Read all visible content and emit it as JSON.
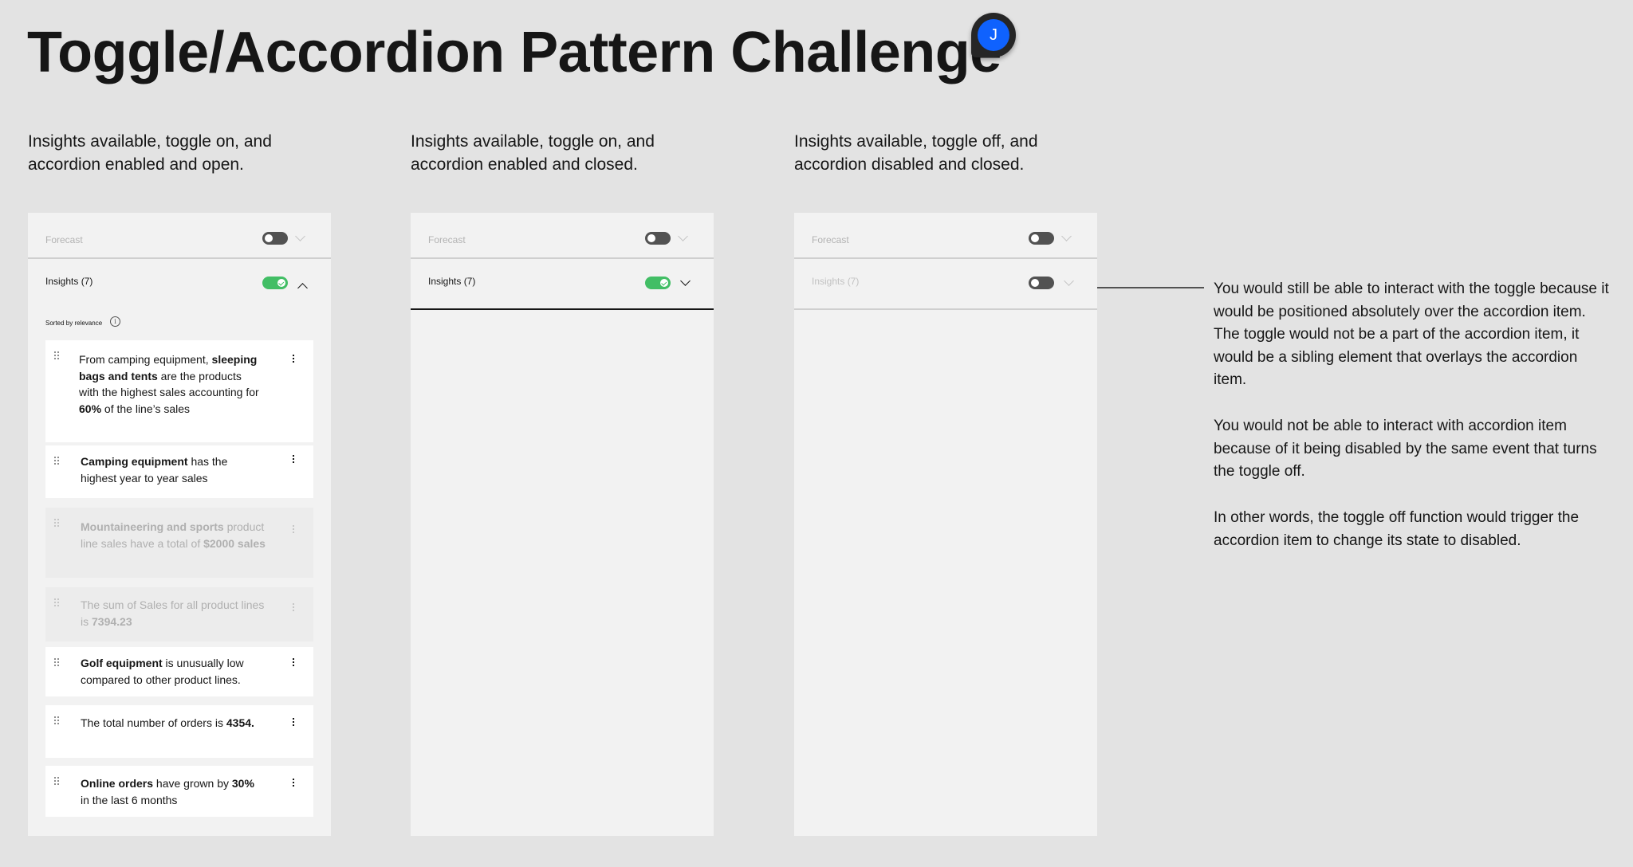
{
  "title": "Toggle/Accordion Pattern Challenge",
  "avatar": {
    "initial": "J",
    "color": "#0f62fe"
  },
  "colors": {
    "background": "#e3e3e3",
    "panel": "#f2f2f2",
    "toggle_on": "#42be65",
    "toggle_off": "#525252"
  },
  "columns": [
    {
      "caption": "Insights available, toggle on, and accordion enabled and open.",
      "forecast": {
        "label": "Forecast",
        "toggle": "off"
      },
      "insights": {
        "label": "Insights (7)",
        "toggle": "on",
        "accordion": "open",
        "enabled": true
      }
    },
    {
      "caption": "Insights available, toggle on, and accordion enabled and closed.",
      "forecast": {
        "label": "Forecast",
        "toggle": "off"
      },
      "insights": {
        "label": "Insights (7)",
        "toggle": "on",
        "accordion": "closed",
        "enabled": true
      }
    },
    {
      "caption": "Insights available, toggle off, and accordion disabled and closed.",
      "forecast": {
        "label": "Forecast",
        "toggle": "off"
      },
      "insights": {
        "label": "Insights (7)",
        "toggle": "off",
        "accordion": "closed",
        "enabled": false
      }
    }
  ],
  "sorted_label": "Sorted by relevance",
  "info_icon": "info-icon",
  "insight_cards": [
    {
      "parts": [
        {
          "t": "From camping equipment, "
        },
        {
          "t": "sleeping bags and tents",
          "b": true
        },
        {
          "t": " are the products with the highest sales accounting for "
        },
        {
          "t": "60%",
          "b": true
        },
        {
          "t": " of the line’s sales"
        }
      ],
      "faded": false
    },
    {
      "parts": [
        {
          "t": "Camping equipment",
          "b": true
        },
        {
          "t": " has the highest year to year sales"
        }
      ],
      "faded": false
    },
    {
      "parts": [
        {
          "t": "Mountaineering and sports",
          "b": true
        },
        {
          "t": " product line sales have a total of "
        },
        {
          "t": "$2000 sales",
          "b": true
        }
      ],
      "faded": true
    },
    {
      "parts": [
        {
          "t": "The sum of Sales for all product lines is "
        },
        {
          "t": "7394.23",
          "b": true
        }
      ],
      "faded": true
    },
    {
      "parts": [
        {
          "t": "Golf equipment",
          "b": true
        },
        {
          "t": " is unusually low compared to other product lines."
        }
      ],
      "faded": false
    },
    {
      "parts": [
        {
          "t": "The total number of orders is "
        },
        {
          "t": "4354.",
          "b": true
        }
      ],
      "faded": false
    },
    {
      "parts": [
        {
          "t": "Online orders",
          "b": true
        },
        {
          "t": " have grown by "
        },
        {
          "t": "30%",
          "b": true
        },
        {
          "t": " in the last 6 months"
        }
      ],
      "faded": false
    }
  ],
  "notes": [
    "You would still be able to interact with the toggle because it would be positioned absolutely over the accordion item. The toggle would not be a part of the accordion item, it would be a sibling element that overlays the accordion item.",
    "You would not be able to interact with accordion item because of it being disabled by the same event that turns the toggle off.",
    "In other words, the toggle off function would trigger the accordion item to change its state to disabled."
  ]
}
